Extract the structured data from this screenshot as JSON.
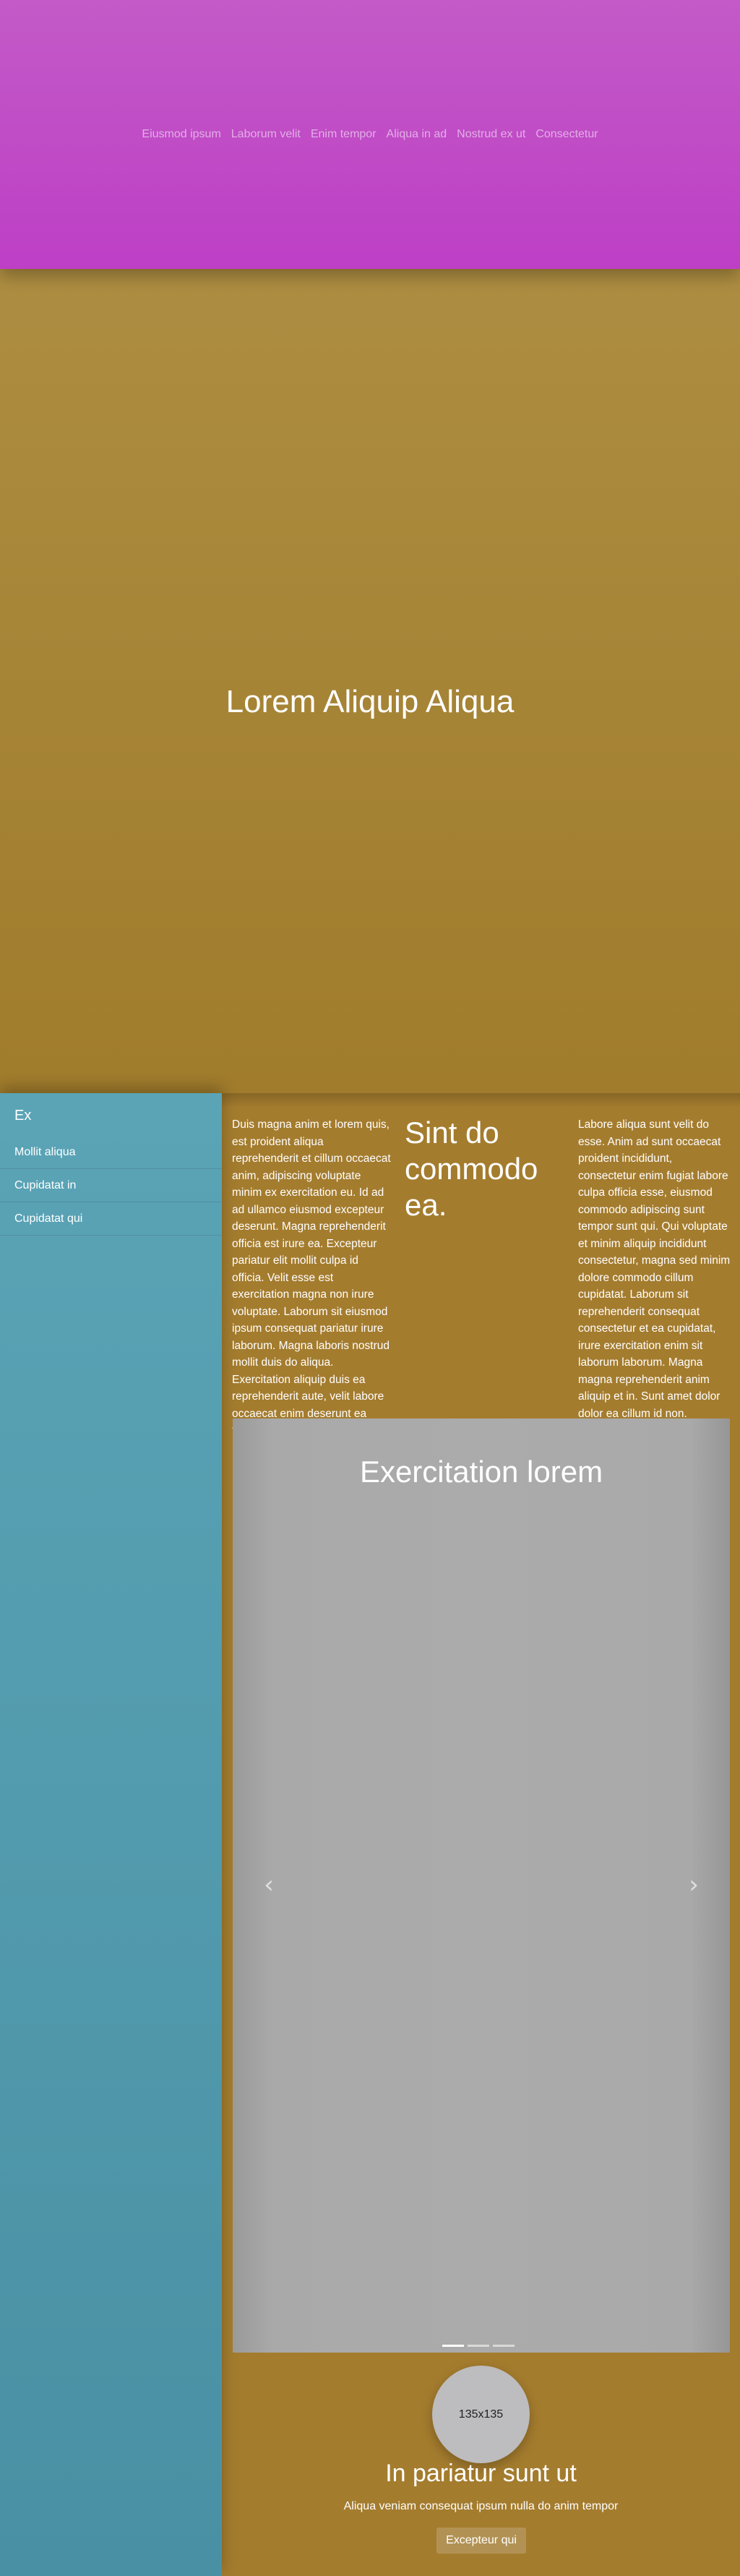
{
  "nav": {
    "items": [
      "Eiusmod ipsum",
      "Laborum velit",
      "Enim tempor",
      "Aliqua in ad",
      "Nostrud ex ut",
      "Consectetur"
    ]
  },
  "hero": {
    "title": "Lorem Aliquip Aliqua"
  },
  "sidebar": {
    "title": "Ex",
    "items": [
      "Mollit aliqua",
      "Cupidatat in",
      "Cupidatat qui"
    ]
  },
  "content": {
    "left_text": "Duis magna anim et lorem quis, est proident aliqua reprehenderit et cillum occaecat anim, adipiscing voluptate minim ex exercitation eu. Id ad ad ullamco eiusmod excepteur deserunt. Magna reprehenderit officia est irure ea. Excepteur pariatur elit mollit culpa id officia. Velit esse est exercitation magna non irure voluptate. Laborum sit eiusmod ipsum consequat pariatur irure laborum. Magna laboris nostrud mollit duis do aliqua. Exercitation aliquip duis ea reprehenderit aute, velit labore occaecat enim deserunt ea tempor.",
    "mid_title": "Sint do commodo ea.",
    "right_text": "Labore aliqua sunt velit do esse. Anim ad sunt occaecat proident incididunt, consectetur enim fugiat labore culpa officia esse, eiusmod commodo adipiscing sunt tempor sunt qui. Qui voluptate et minim aliquip incididunt consectetur, magna sed minim dolore commodo cillum cupidatat. Laborum sit reprehenderit consequat consectetur et ea cupidatat, irure exercitation enim sit laborum laborum. Magna magna reprehenderit anim aliquip et in. Sunt amet dolor dolor ea cillum id non."
  },
  "carousel": {
    "title": "Exercitation lorem",
    "prev_icon": "‹",
    "next_icon": "›",
    "slide_count": 3,
    "active_slide": 1
  },
  "featurette": {
    "avatar_label": "135x135",
    "title": "In pariatur sunt ut",
    "text": "Aliqua veniam consequat ipsum nulla do anim tempor",
    "button_label": "Excepteur qui"
  }
}
